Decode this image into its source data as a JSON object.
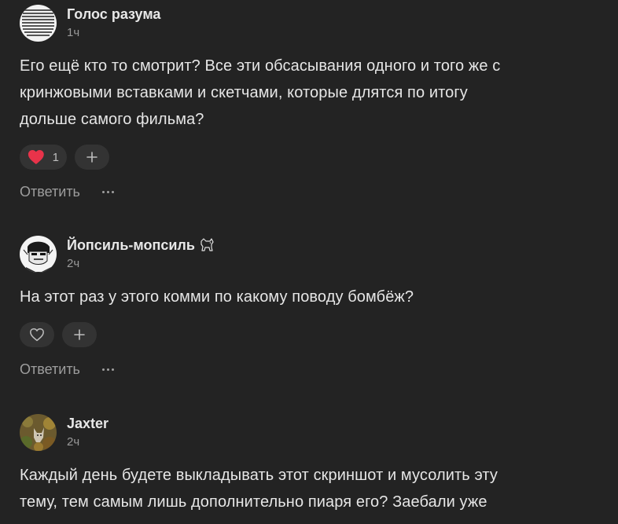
{
  "comments": [
    {
      "author": "Голос разума",
      "time": "1ч",
      "text_lines": [
        "Его ещё кто то смотрит? Все эти обсасывания одного и того же с",
        "кринжовыми вставками и скетчами, которые длятся по итогу",
        "дольше самого фильма?"
      ],
      "likes": "1",
      "liked": true,
      "reply_label": "Ответить"
    },
    {
      "author": "Йопсиль-мопсиль",
      "author_badge": "dog-emoji",
      "time": "2ч",
      "text_lines": [
        "На этот раз у этого комми по какому поводу бомбёж?"
      ],
      "liked": false,
      "reply_label": "Ответить"
    },
    {
      "author": "Jaxter",
      "time": "2ч",
      "text_lines": [
        "Каждый день будете выкладывать этот скриншот и мусолить эту",
        "тему, тем самым лишь дополнительно пиаря его? Заебали уже"
      ],
      "reply_label": "Ответить"
    }
  ],
  "icons": {
    "like": "heart-icon",
    "add": "plus-icon",
    "more": "more-dots-icon"
  },
  "colors": {
    "background": "#232323",
    "pill": "#333333",
    "heart_active": "#e8334a",
    "text": "#e6e6e6",
    "muted": "#9a9a9a"
  }
}
